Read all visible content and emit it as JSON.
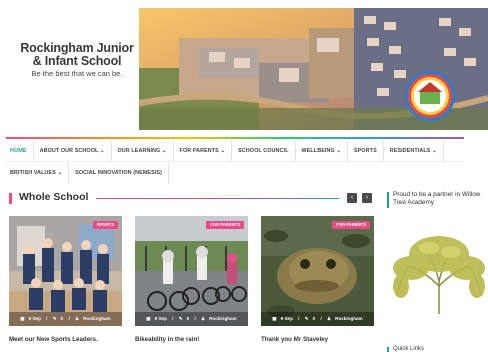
{
  "school": {
    "name_line1": "Rockingham Junior",
    "name_line2": "& Infant School",
    "tagline": "Be the best that we can be."
  },
  "nav": {
    "row1": [
      {
        "label": "HOME",
        "active": true
      },
      {
        "label": "ABOUT OUR SCHOOL ⌄"
      },
      {
        "label": "OUR LEARNING ⌄"
      },
      {
        "label": "FOR PARENTS ⌄"
      },
      {
        "label": "SCHOOL COUNCIL"
      },
      {
        "label": "WELLBEING ⌄"
      },
      {
        "label": "SPORTS"
      },
      {
        "label": "RESIDENTIALS ⌄"
      }
    ],
    "row2": [
      {
        "label": "BRITISH VALUES ⌄"
      },
      {
        "label": "SOCIAL INNOVATION (NEMESIS)"
      }
    ]
  },
  "section": {
    "title": "Whole School",
    "prev_icon": "chevron-left-icon",
    "next_icon": "chevron-right-icon",
    "prev_glyph": "‹",
    "next_glyph": "›"
  },
  "posts": [
    {
      "badge": "SPORTS",
      "date": "9 Sep",
      "comments": "0",
      "author": "Rockingham",
      "title": "Meet our New Sports Leaders."
    },
    {
      "badge": "FOR PARENTS",
      "date": "9 Sep",
      "comments": "0",
      "author": "Rockingham",
      "title": "Bikeability in the rain!"
    },
    {
      "badge": "FOR PARENTS",
      "date": "9 Sep",
      "comments": "0",
      "author": "Rockingham",
      "title": "Thank you Mr Staveley"
    }
  ],
  "meta_icons": {
    "date": "▦",
    "comments": "✎",
    "author": "♟",
    "sep": "/"
  },
  "sidebar": {
    "partner_title": "Proud to be a partner in Willow Tree Academy",
    "quick_links": "Quick Links"
  },
  "colors": {
    "accent_pink": "#e84c88",
    "accent_teal": "#2a9d8f",
    "arrow_bg": "#4a4a4a"
  }
}
